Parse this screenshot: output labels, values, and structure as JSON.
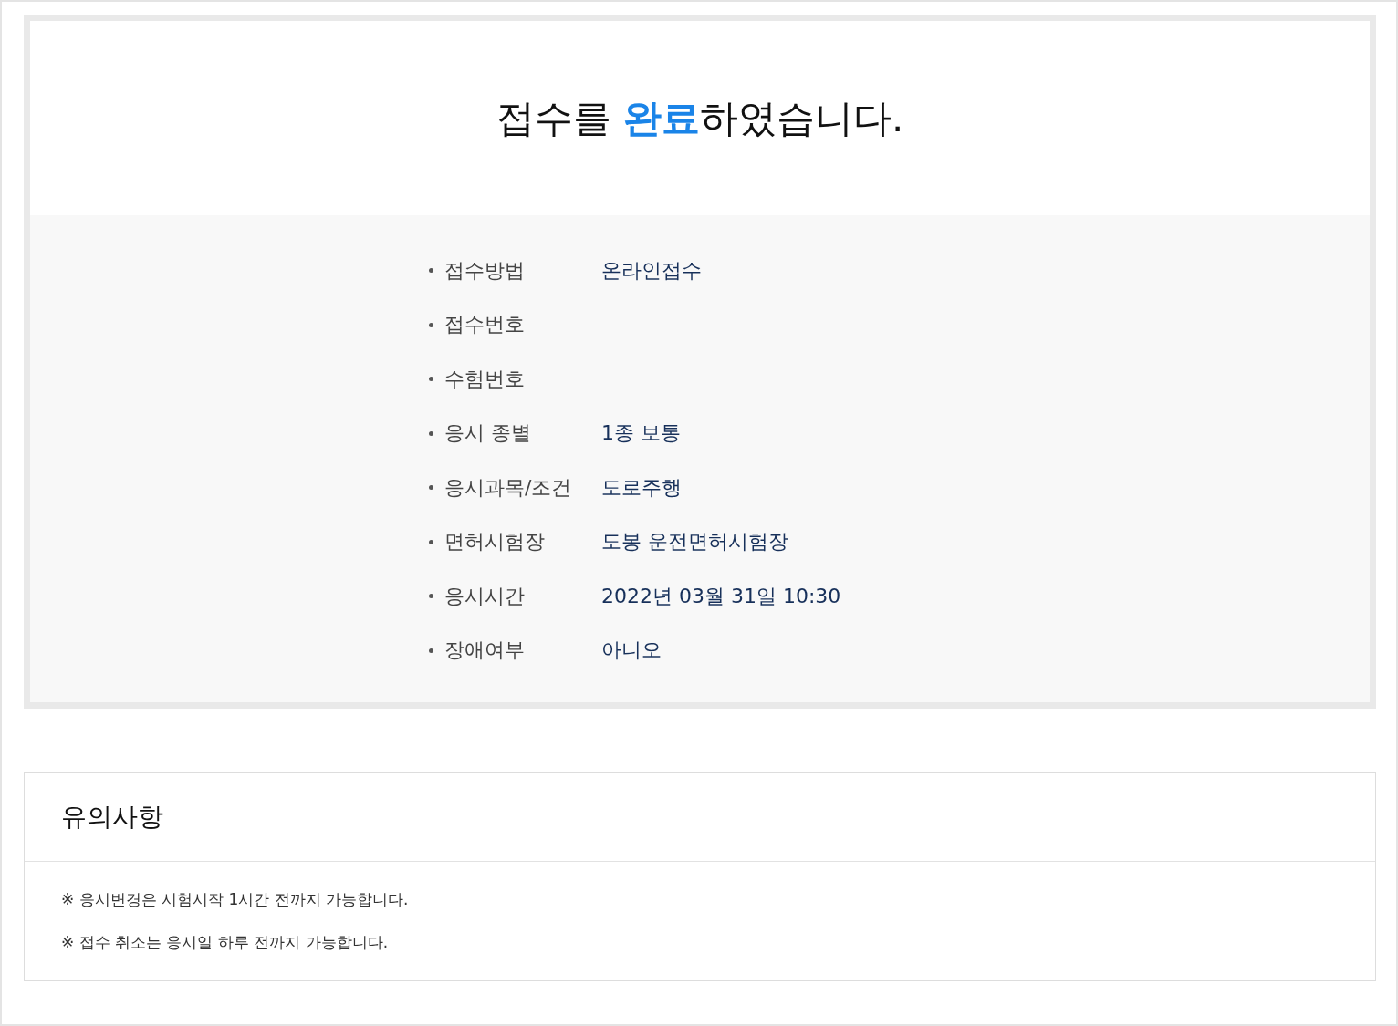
{
  "title": {
    "parts": [
      {
        "text": "접수를 ",
        "highlight": false
      },
      {
        "text": "완료",
        "highlight": true
      },
      {
        "text": "하였습니다.",
        "highlight": false
      }
    ]
  },
  "details": [
    {
      "label": "접수방법",
      "value": "온라인접수"
    },
    {
      "label": "접수번호"
    },
    {
      "label": "수험번호"
    },
    {
      "label": "응시 종별",
      "value": "1종 보통"
    },
    {
      "label": "응시과목/조건",
      "value": "도로주행"
    },
    {
      "label": "면허시험장",
      "value": "도봉 운전면허시험장"
    },
    {
      "label": "응시시간",
      "value": "2022년 03월 31일 10:30"
    },
    {
      "label": "장애여부",
      "value": "아니오"
    }
  ],
  "notice": {
    "heading": "유의사항",
    "notes": [
      "※ 응시변경은 시험시작 1시간 전까지 가능합니다.",
      "※ 접수 취소는 응시일 하루 전까지 가능합니다."
    ]
  }
}
